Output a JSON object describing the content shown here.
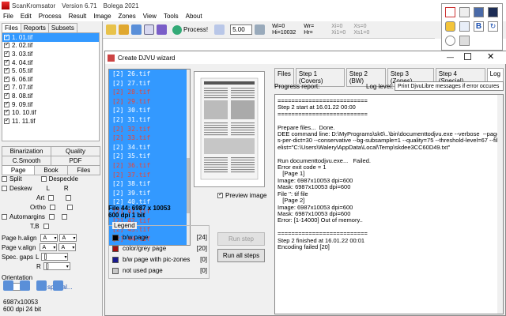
{
  "app": {
    "name": "ScanKromsator",
    "version": "Version 6.71",
    "copyright": "Bolega 2021"
  },
  "menu": [
    "File",
    "Edit",
    "Process",
    "Result",
    "Image",
    "Zones",
    "View",
    "Tools",
    "About"
  ],
  "toolbar": {
    "process_label": "Process!",
    "zoom_value": "5.00",
    "wh_line1": "Wi=0",
    "wh_line2": "Hi=10032",
    "wr_line1": "Wr=",
    "wr_line2": "Hr=",
    "xi_line1": "Xi=0",
    "xi_line2": "Xi1=0",
    "xs_line1": "Xs=0",
    "xs_line2": "Xs1=0"
  },
  "left": {
    "tabs": [
      "Files",
      "Reports",
      "Subsets"
    ],
    "files": [
      "1. 01.tif",
      "2. 02.tif",
      "3. 03.tif",
      "4. 04.tif",
      "5. 05.tif",
      "6. 06.tif",
      "7. 07.tif",
      "8. 08.tif",
      "9. 09.tif",
      "10. 10.tif",
      "11. 11.tif"
    ],
    "settings_row1": [
      "Binarization",
      "Quality"
    ],
    "settings_row2": [
      "C.Smooth",
      "PDF"
    ],
    "settings_row3": [
      "Page",
      "Book",
      "Files"
    ],
    "split": "Split",
    "despeckle": "Despeckle",
    "deskew": "Deskew",
    "l": "L",
    "r": "R",
    "art": "Art",
    "ortho": "Ortho",
    "automargins": "Automargins",
    "tb": "T,B",
    "page_halign": "Page h.align",
    "page_valign": "Page v.align",
    "align_a": "A",
    "spec_gaps": "Spec. gaps",
    "spec_l": "L",
    "spec_r": "R",
    "spec_val": "[]",
    "orientation": "Orientation",
    "orientation_val": "0",
    "special": "special...",
    "footer_line1": "6987x10053",
    "footer_line2": "600 dpi   24 bit"
  },
  "dialog": {
    "title": "Create DJVU wizard",
    "pages": [
      {
        "t": "[2] 26.tif",
        "red": false
      },
      {
        "t": "[2] 27.tif",
        "red": false
      },
      {
        "t": "[2] 28.tif",
        "red": true
      },
      {
        "t": "[2] 29.tif",
        "red": true
      },
      {
        "t": "[2] 30.tif",
        "red": false
      },
      {
        "t": "[2] 31.tif",
        "red": false
      },
      {
        "t": "[2] 32.tif",
        "red": true
      },
      {
        "t": "[2] 33.tif",
        "red": true
      },
      {
        "t": "[2] 34.tif",
        "red": false
      },
      {
        "t": "[2] 35.tif",
        "red": false
      },
      {
        "t": "[2] 36.tif",
        "red": true
      },
      {
        "t": "[2] 37.tif",
        "red": true
      },
      {
        "t": "[2] 38.tif",
        "red": false
      },
      {
        "t": "[2] 39.tif",
        "red": false
      },
      {
        "t": "[2] 40.tif",
        "red": false
      },
      {
        "t": "[2] 41.tif",
        "red": true
      },
      {
        "t": "[2] 42.tif",
        "red": true
      },
      {
        "t": "[2] 43.tif",
        "red": true
      },
      {
        "t": "[2] 44.tif",
        "red": true
      }
    ],
    "preview_label": "Preview image",
    "file_info1": "File 44: 6987 x 10053",
    "file_info2": "600 dpi   1 bit",
    "legend": {
      "title": "Legend",
      "items": [
        {
          "label": "b/w page",
          "count": "[24]",
          "color": "#000000"
        },
        {
          "label": "color/grey page",
          "count": "[20]",
          "color": "#a50f0f"
        },
        {
          "label": "b/w page with pic-zones",
          "count": "[0]",
          "color": "#1b1b8f"
        },
        {
          "label": "not used page",
          "count": "[0]",
          "color": "#c8c8c8"
        }
      ]
    },
    "run_step": "Run step",
    "run_all": "Run all steps",
    "tabs": [
      "Files",
      "Step 1 (Covers)",
      "Step 2 (BW)",
      "Step 3 (Zones)",
      "Step 4 (Special)",
      "Log"
    ],
    "progress_label": "Progress report:",
    "loglevel_label": "Log level:",
    "loglevel_value": "Print DjvuLibre messages if error occures",
    "log": [
      "==========================",
      "Step 2 start at 16.01.22 00:00",
      "==========================",
      "",
      "Prepare files...  Done.",
      "DEE command line: D:\\MyPrograms\\sk6\\..\\bin\\documenttodjvu.exe --verbose  --pages-per-dict=30 --conservative --bg-subsample=1 --quality=75 --threshold-level=67 --filelist=\"C:\\Users\\Walery\\AppData\\Local\\Temp\\skdee3CC60D49.txt\"",
      "",
      "Run documenttodjvu.exe...   Failed.",
      "Error exit code = 1",
      "   [Page 1]",
      "Image: 6987x10053 dpi=600",
      "Mask: 6987x10053 dpi=600",
      "File '': tif file",
      "   [Page 2]",
      "Image: 6987x10053 dpi=600",
      "Mask: 6987x10053 dpi=600",
      "Error: [1-14000] Out of memory..",
      "",
      "==========================",
      "Step 2 finished at 16.01.22 00:01",
      "Encoding failed [20]"
    ]
  }
}
